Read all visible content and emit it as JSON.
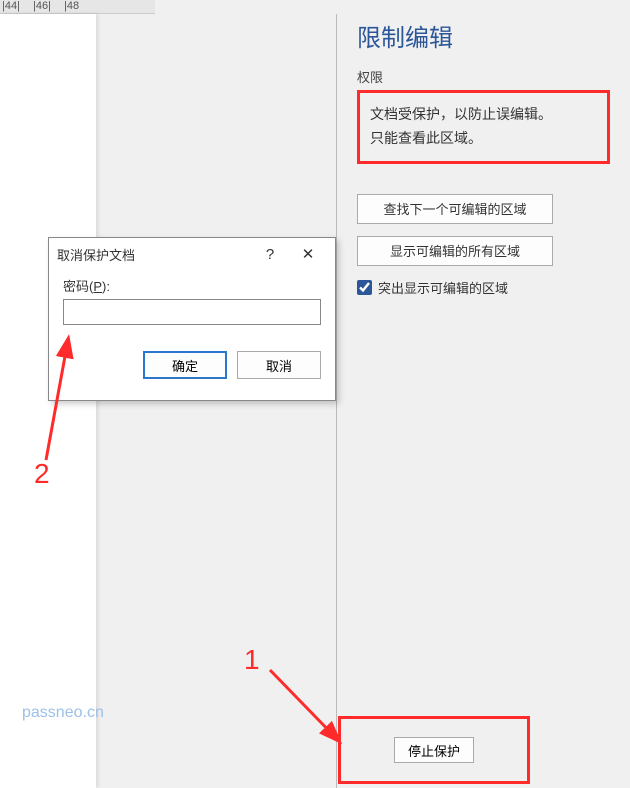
{
  "ruler": {
    "t1": "|44|",
    "t2": "|46|",
    "t3": "|48"
  },
  "pane": {
    "title": "限制编辑",
    "section_label": "权限",
    "info_line1": "文档受保护，以防止误编辑。",
    "info_line2": "只能查看此区域。",
    "btn_find_next": "查找下一个可编辑的区域",
    "btn_show_all": "显示可编辑的所有区域",
    "checkbox_label": "突出显示可编辑的区域",
    "checkbox_checked": true,
    "stop_protect": "停止保护"
  },
  "dialog": {
    "title": "取消保护文档",
    "help": "?",
    "close": "✕",
    "password_label_pre": "密码(",
    "password_label_u": "P",
    "password_label_post": "):",
    "ok": "确定",
    "cancel": "取消"
  },
  "annotations": {
    "num1": "1",
    "num2": "2",
    "watermark": "passneo.cn"
  }
}
